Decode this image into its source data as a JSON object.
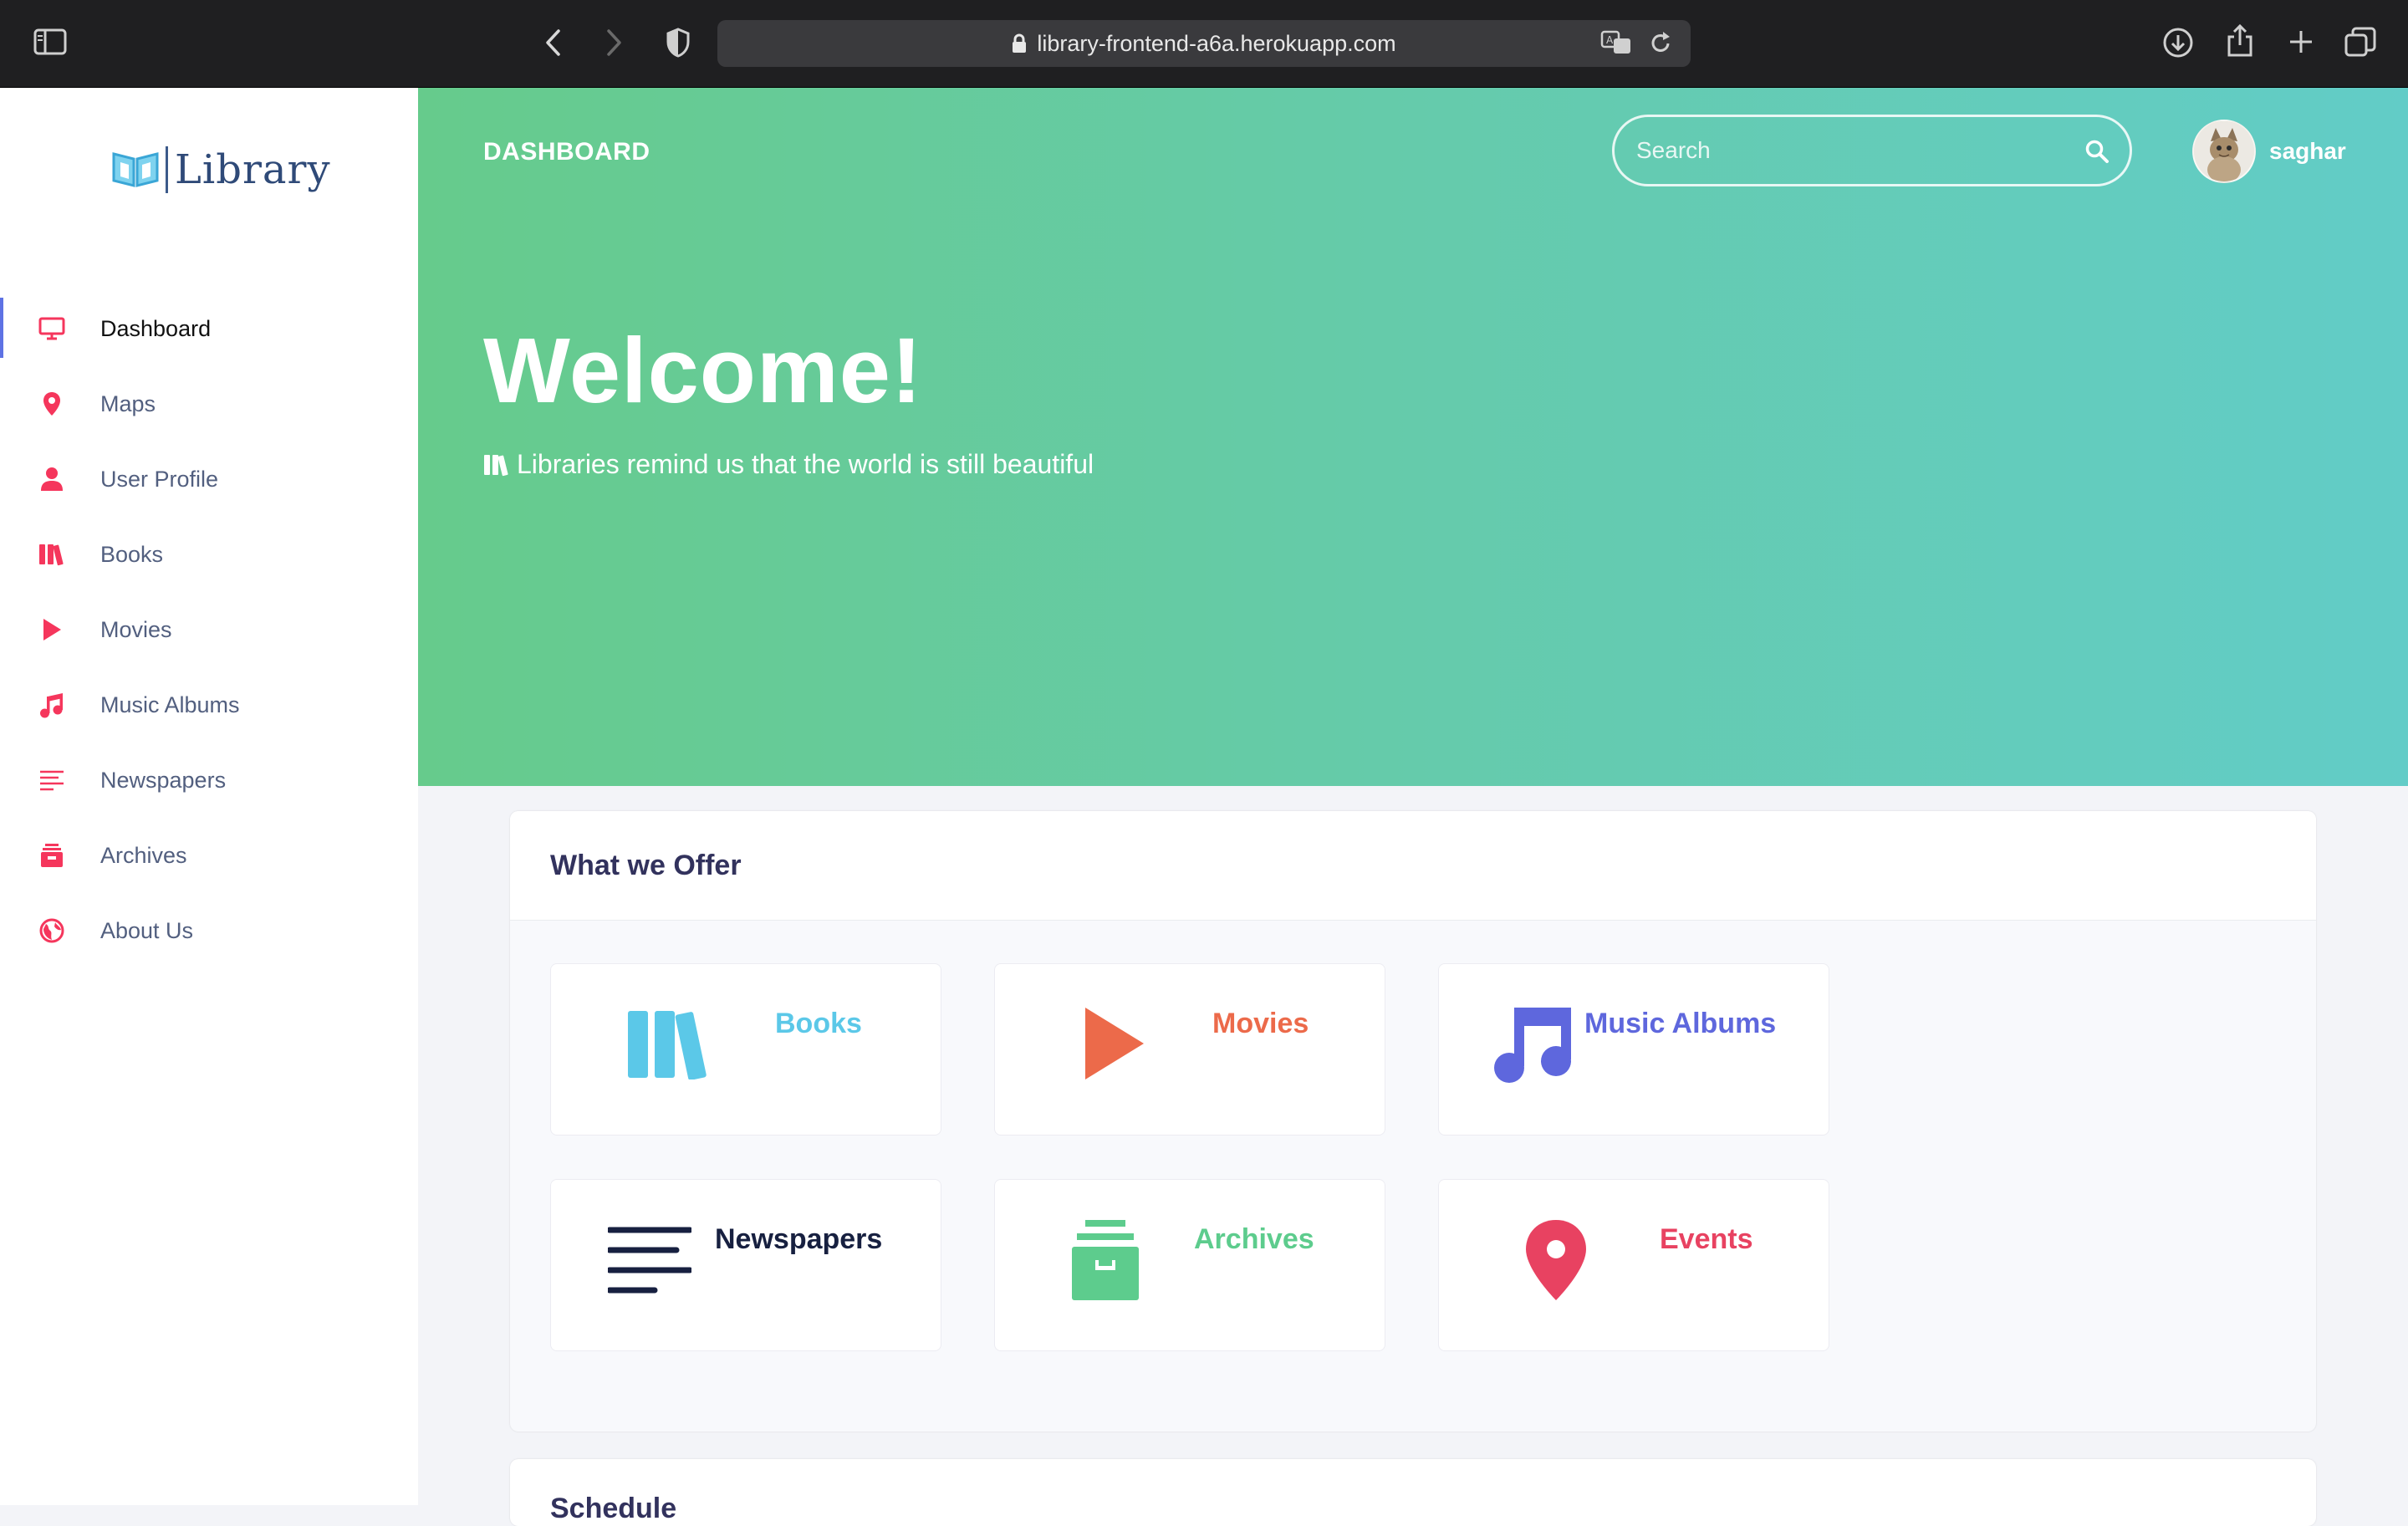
{
  "browser": {
    "url": "library-frontend-a6a.herokuapp.com"
  },
  "sidebar": {
    "brand": "Library",
    "items": [
      {
        "label": "Dashboard",
        "icon": "monitor-icon",
        "active": true
      },
      {
        "label": "Maps",
        "icon": "map-pin-icon"
      },
      {
        "label": "User Profile",
        "icon": "user-icon"
      },
      {
        "label": "Books",
        "icon": "books-icon"
      },
      {
        "label": "Movies",
        "icon": "play-icon"
      },
      {
        "label": "Music Albums",
        "icon": "music-icon"
      },
      {
        "label": "Newspapers",
        "icon": "lines-icon"
      },
      {
        "label": "Archives",
        "icon": "archive-icon"
      },
      {
        "label": "About Us",
        "icon": "globe-icon"
      }
    ]
  },
  "header": {
    "title": "DASHBOARD",
    "search_placeholder": "Search",
    "username": "saghar"
  },
  "hero": {
    "title": "Welcome!",
    "subtitle": "Libraries remind us that the world is still beautiful"
  },
  "offer": {
    "title": "What we Offer",
    "tiles": [
      {
        "label": "Books",
        "icon": "books-icon",
        "color": "#5bc8e8"
      },
      {
        "label": "Movies",
        "icon": "play-icon",
        "color": "#ec6a4a"
      },
      {
        "label": "Music Albums",
        "icon": "music-icon",
        "color": "#5e67dd"
      },
      {
        "label": "Newspapers",
        "icon": "lines-icon",
        "color": "#172040"
      },
      {
        "label": "Archives",
        "icon": "archive-icon",
        "color": "#5dcc8d"
      },
      {
        "label": "Events",
        "icon": "map-pin-icon",
        "color": "#e84261"
      }
    ]
  },
  "schedule": {
    "title": "Schedule"
  },
  "colors": {
    "accent": "#5e72e4",
    "sidebar_icon": "#f5365c",
    "hero_start": "#66cb8c",
    "hero_end": "#62ccc7"
  }
}
